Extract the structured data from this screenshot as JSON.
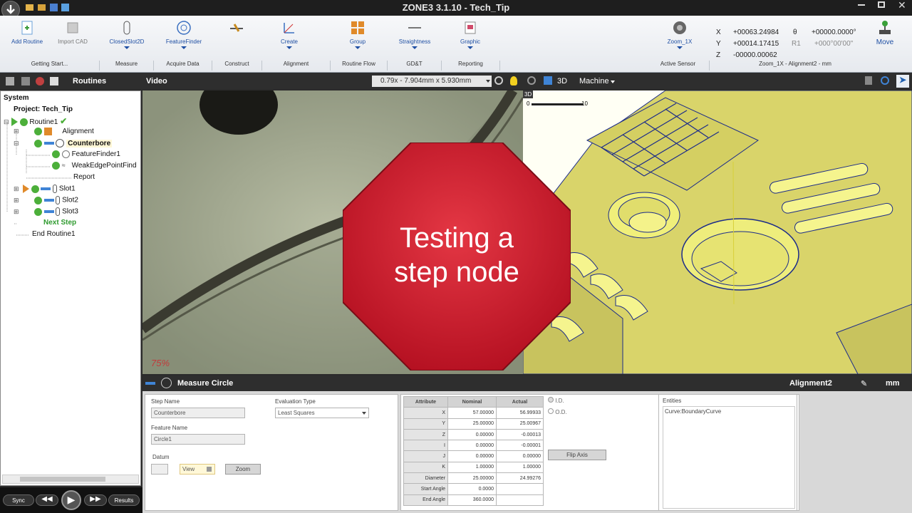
{
  "app": {
    "title": "ZONE3 3.1.10 - Tech_Tip"
  },
  "ribbon": {
    "buttons": [
      {
        "label": "Add Routine"
      },
      {
        "label": "Import CAD"
      },
      {
        "label": "ClosedSlot2D"
      },
      {
        "label": "FeatureFinder"
      },
      {
        "label": ""
      },
      {
        "label": "Create"
      },
      {
        "label": "Group"
      },
      {
        "label": "Straightness"
      },
      {
        "label": "Graphic"
      },
      {
        "label": "Zoom_1X"
      },
      {
        "label": "Move"
      }
    ],
    "groups": [
      "Getting Start...",
      "Measure",
      "Acquire Data",
      "Construct",
      "Alignment",
      "Routine Flow",
      "GD&T",
      "Reporting",
      "Active Sensor",
      "Zoom_1X - Alignment2 - mm"
    ]
  },
  "coords": {
    "x_label": "X",
    "x": "+00063.24984",
    "y_label": "Y",
    "y": "+00014.17415",
    "z_label": "Z",
    "z": "-00000.00062",
    "theta_label": "θ",
    "theta": "+00000.0000°",
    "r1_label": "R1",
    "r1": "+000°00'00\""
  },
  "tabs": {
    "routines": "Routines",
    "video": "Video",
    "view_dims": "0.79x - 7.904mm x 5.930mm",
    "view_mode": "3D",
    "machine": "Machine"
  },
  "tree": [
    {
      "label": "System",
      "bold": true
    },
    {
      "label": "Project: Tech_Tip",
      "bold": true
    },
    {
      "label": "Routine1"
    },
    {
      "label": "Alignment"
    },
    {
      "label": "Counterbore",
      "bold": true
    },
    {
      "label": "FeatureFinder1"
    },
    {
      "label": "WeakEdgePointFind"
    },
    {
      "label": "Report"
    },
    {
      "label": "Slot1"
    },
    {
      "label": "Slot2"
    },
    {
      "label": "Slot3"
    },
    {
      "label": "Next Step",
      "bold": true
    },
    {
      "label": "End Routine1"
    }
  ],
  "video": {
    "zoom": "75%"
  },
  "cad": {
    "badge": "3D",
    "scale_start": "0",
    "scale_end": "10"
  },
  "overlay": {
    "line1": "Testing a",
    "line2": "step node"
  },
  "measure_bar": {
    "title": "Measure Circle",
    "alignment": "Alignment2",
    "units": "mm"
  },
  "step": {
    "step_name_label": "Step Name",
    "step_name": "Counterbore",
    "eval_label": "Evaluation Type",
    "eval_value": "Least Squares",
    "feature_name_label": "Feature Name",
    "feature_name": "Circle1",
    "datum_label": "Datum",
    "view_button": "View",
    "zoom_button": "Zoom"
  },
  "attributes": {
    "headers": [
      "Attribute",
      "Nominal",
      "Actual"
    ],
    "rows": [
      [
        "X",
        "57.00000",
        "56.99933"
      ],
      [
        "Y",
        "25.00000",
        "25.00967"
      ],
      [
        "Z",
        "0.00000",
        "-0.00013"
      ],
      [
        "I",
        "0.00000",
        "-0.00001"
      ],
      [
        "J",
        "0.00000",
        "0.00000"
      ],
      [
        "K",
        "1.00000",
        "1.00000"
      ],
      [
        "Diameter",
        "25.00000",
        "24.99276"
      ],
      [
        "Start Angle",
        "0.0000",
        ""
      ],
      [
        "End Angle",
        "360.0000",
        ""
      ]
    ]
  },
  "options": {
    "id_label": "I.D.",
    "od_label": "O.D.",
    "flip_axis": "Flip Axis"
  },
  "entities": {
    "label": "Entities",
    "item": "Curve:BoundaryCurve"
  },
  "player": {
    "sync": "Sync",
    "results": "Results"
  },
  "colors": {
    "ribbon_text": "#1f4fa3",
    "stop_red": "#c8182b",
    "cad_yellow": "#f1f08a",
    "panel_dark": "#2e2e2e"
  }
}
